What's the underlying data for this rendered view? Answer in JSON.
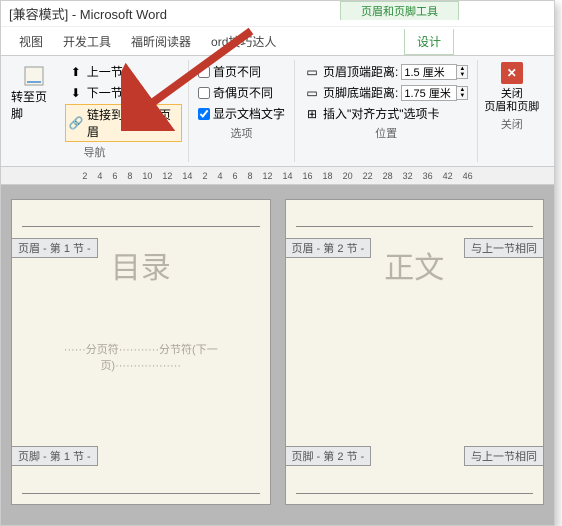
{
  "title": "[兼容模式] - Microsoft Word",
  "contextGroup": "页眉和页脚工具",
  "tabs": {
    "view": "视图",
    "dev": "开发工具",
    "foxit": "福昕阅读器",
    "tips": "ord技巧达人",
    "design": "设计"
  },
  "nav": {
    "gotoFooter": "转至页脚",
    "prev": "上一节",
    "next": "下一节",
    "linkPrev": "链接到前一条页眉",
    "label": "导航"
  },
  "options": {
    "firstDiff": "首页不同",
    "oddEvenDiff": "奇偶页不同",
    "showDoc": "显示文档文字",
    "label": "选项"
  },
  "position": {
    "hdrDist": "页眉顶端距离:",
    "ftrDist": "页脚底端距离:",
    "hdrVal": "1.5 厘米",
    "ftrVal": "1.75 厘米",
    "insertAlign": "插入\"对齐方式\"选项卡",
    "label": "位置"
  },
  "close": {
    "btn": "关闭\n页眉和页脚",
    "label": "关闭"
  },
  "ruler": [
    "2",
    "4",
    "6",
    "8",
    "10",
    "12",
    "14",
    "2",
    "4",
    "6",
    "8",
    "12",
    "14",
    "16",
    "18",
    "20",
    "22",
    "28",
    "32",
    "36",
    "42",
    "46"
  ],
  "pages": {
    "left": {
      "hdrTag": "页眉 - 第 1 节 -",
      "title": "目录",
      "break": "······分页符···········分节符(下一页)··················",
      "ftrTag": "页脚 - 第 1 节 -"
    },
    "right": {
      "hdrTag": "页眉 - 第 2 节 -",
      "sameTop": "与上一节相同",
      "title": "正文",
      "ftrTag": "页脚 - 第 2 节 -",
      "sameBot": "与上一节相同"
    }
  }
}
